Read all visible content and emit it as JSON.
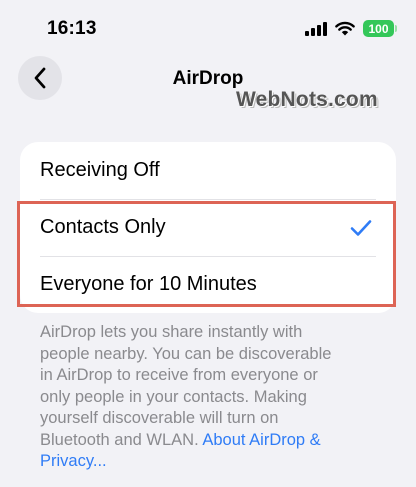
{
  "status_bar": {
    "time": "16:13",
    "signal_icon": "cellular-signal-icon",
    "wifi_icon": "wifi-icon",
    "battery_level": "100",
    "battery_color": "#34c759"
  },
  "nav": {
    "back_icon": "chevron-left-icon",
    "title": "AirDrop"
  },
  "watermark": "WebNots.com",
  "options": [
    {
      "label": "Receiving Off",
      "selected": false
    },
    {
      "label": "Contacts Only",
      "selected": true
    },
    {
      "label": "Everyone for 10 Minutes",
      "selected": false
    }
  ],
  "check_icon": "checkmark-icon",
  "highlight_color": "#dd6455",
  "footnote": {
    "lines": [
      "AirDrop lets you share instantly with",
      "people nearby. You can be discoverable",
      "in AirDrop to receive from everyone or",
      "only people in your contacts. Making",
      "yourself discoverable will turn on",
      "Bluetooth and WLAN. "
    ],
    "link_part1": "About AirDrop &",
    "link_part2": "Privacy..."
  },
  "colors": {
    "background": "#f2f2f6",
    "card": "#ffffff",
    "accent": "#2f7cf6",
    "secondary_text": "#8a8a8e"
  }
}
